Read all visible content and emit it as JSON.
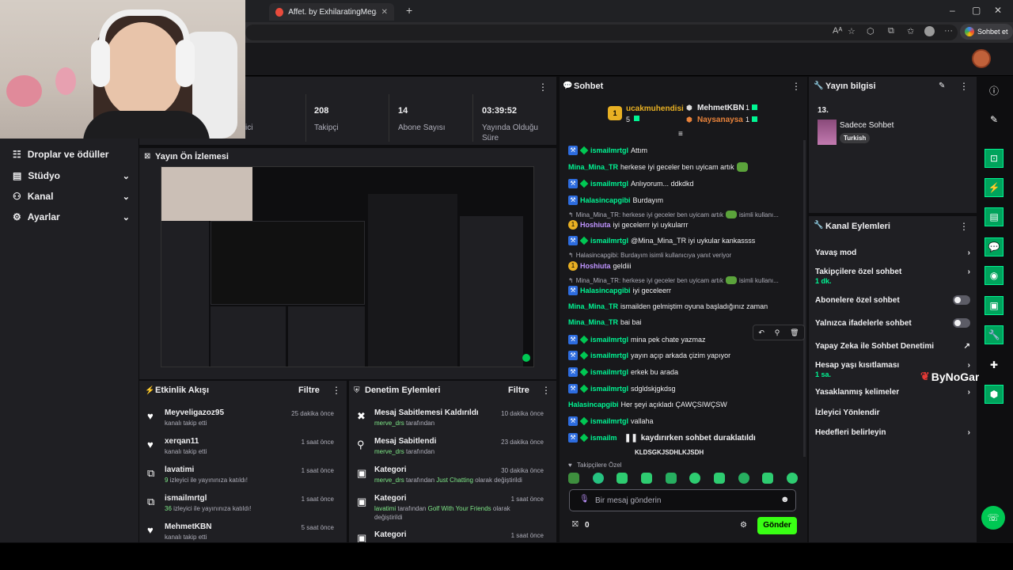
{
  "browser": {
    "tab_title": "Affet. by ExhilaratingMegaphones",
    "sohbet_et": "Sohbet et"
  },
  "leftnav": {
    "items": [
      {
        "label": "Droplar ve ödüller"
      },
      {
        "label": "Stüdyo"
      },
      {
        "label": "Kanal"
      },
      {
        "label": "Ayarlar"
      }
    ]
  },
  "stats": {
    "partial_label": "ici",
    "followers": {
      "value": "208",
      "label": "Takipçi"
    },
    "subs": {
      "value": "14",
      "label": "Abone Sayısı"
    },
    "uptime": {
      "value": "03:39:52",
      "label1": "Yayında Olduğu",
      "label2": "Süre"
    }
  },
  "preview": {
    "title": "Yayın Ön İzlemesi"
  },
  "activity": {
    "title": "Etkinlik Akışı",
    "filter": "Filtre",
    "items": [
      {
        "name": "Meyveligazoz95",
        "sub": "kanalı takip etti",
        "time": "25 dakika önce"
      },
      {
        "name": "xerqan11",
        "sub": "kanalı takip etti",
        "time": "1 saat önce"
      },
      {
        "name": "lavatimi",
        "sub_count": "9",
        "sub": " izleyici ile yayınınıza katıldı!",
        "time": "1 saat önce"
      },
      {
        "name": "ismailmrtgl",
        "sub_count": "36",
        "sub": " izleyici ile yayınınıza katıldı!",
        "time": "1 saat önce"
      },
      {
        "name": "MehmetKBN",
        "sub": "kanalı takip etti",
        "time": "5 saat önce"
      }
    ]
  },
  "moderation": {
    "title": "Denetim Eylemleri",
    "filter": "Filtre",
    "items": [
      {
        "title": "Mesaj Sabitlemesi Kaldırıldı",
        "user": "merve_drs",
        "tail": " tarafından",
        "time": "10 dakika önce"
      },
      {
        "title": "Mesaj Sabitlendi",
        "user": "merve_drs",
        "tail": " tarafından",
        "time": "23 dakika önce"
      },
      {
        "title": "Kategori",
        "user": "merve_drs",
        "tail": " tarafından ",
        "cat": "Just Chatting",
        "tail2": " olarak değiştirildi",
        "time": "30 dakika önce"
      },
      {
        "title": "Kategori",
        "user": "lavatimi",
        "tail": " tarafından ",
        "cat": "Golf With Your Friends",
        "tail2": " olarak",
        "line2": "değiştirildi",
        "time": "1 saat önce"
      },
      {
        "title": "Kategori",
        "time": "1 saat önce"
      }
    ]
  },
  "chat": {
    "title": "Sohbet",
    "leader1": {
      "rank": "1",
      "name": "ucakmuhendisi",
      "count": "5"
    },
    "leader2": {
      "name": "MehmetKBN",
      "count": "1"
    },
    "leader3": {
      "name": "Naysanaysa",
      "count": "1"
    },
    "messages": [
      {
        "user": "ismailmrtgl",
        "text": "Attım"
      },
      {
        "user": "Mina_Mina_TR",
        "text": "herkese iyi geceler ben uyicam artık"
      },
      {
        "user": "ismailmrtgl",
        "text": "Anlıyorum... ddkdkd"
      },
      {
        "user": "Halasincapgibi",
        "text": "Burdayım"
      },
      {
        "reply": "Mina_Mina_TR: herkese iyi geceler ben uyicam artık",
        "reply_tail": "isimli kullanı..."
      },
      {
        "user": "Hoshiuta",
        "text": "iyi gecelerrr iyi uykularrr"
      },
      {
        "user": "ismailmrtgl",
        "text": "@Mina_Mina_TR iyi uykular kankassss"
      },
      {
        "reply": "Halasincapgibi: Burdayım isimli kullanıcıya yanıt veriyor"
      },
      {
        "user": "Hoshiuta",
        "text": "geldiii"
      },
      {
        "reply": "Mina_Mina_TR: herkese iyi geceler ben uyicam artık",
        "reply_tail": "isimli kullanı..."
      },
      {
        "user": "Halasincapgibi",
        "text": "iyi geceleerr"
      },
      {
        "user": "Mina_Mina_TR",
        "text": "ismailden gelmiştim oyuna başladığınız zaman"
      },
      {
        "user": "Mina_Mina_TR",
        "text": "bai bai"
      },
      {
        "user": "ismailmrtgl",
        "text": "mina pek chate yazmaz"
      },
      {
        "user": "ismailmrtgl",
        "text": "yayın açıp arkada çizim yapıyor"
      },
      {
        "user": "ismailmrtgl",
        "text": "erkek bu arada"
      },
      {
        "user": "ismailmrtgl",
        "text": "sdgldskjgkdsg"
      },
      {
        "user": "Halasincapgibi",
        "text": "Her şeyi açıkladı ÇAWÇSIWÇSW"
      },
      {
        "user": "ismailmrtgl",
        "text": "vallaha"
      },
      {
        "user": "ismailm",
        "text": ""
      }
    ],
    "paused": "kaydırırken sohbet duraklatıldı",
    "cut_line": "KLDSGKJSDHLKJSDH",
    "followers_only": "Takipçilere Özel",
    "placeholder": "Bir mesaj gönderin",
    "points": "0",
    "send": "Gönder"
  },
  "info": {
    "title": "Yayın bilgisi",
    "number": "13.",
    "stream_title": "Sadece Sohbet",
    "tag": "Turkish"
  },
  "actions": {
    "title": "Kanal Eylemleri",
    "items": [
      {
        "label": "Yavaş mod",
        "kind": "chevron"
      },
      {
        "label": "Takipçilere özel sohbet",
        "sub": "1 dk.",
        "kind": "chevron"
      },
      {
        "label": "Abonelere özel sohbet",
        "kind": "toggle"
      },
      {
        "label": "Yalnızca ifadelerle sohbet",
        "kind": "toggle"
      },
      {
        "label": "Yapay Zeka ile Sohbet Denetimi",
        "kind": "external"
      },
      {
        "label": "Hesap yaşı kısıtlaması",
        "sub": "1 sa.",
        "kind": "chevron"
      },
      {
        "label": "Yasaklanmış kelimeler",
        "kind": "chevron"
      },
      {
        "label": "İzleyici Yönlendir",
        "kind": "none"
      },
      {
        "label": "Hedefleri belirleyin",
        "kind": "chevron"
      }
    ]
  },
  "watermark": "ByNoGame",
  "colors": {
    "accent_green": "#00f593",
    "purple": "#bf94ff",
    "badge_blue": "#2d6cdf",
    "send_green": "#39ff14"
  }
}
